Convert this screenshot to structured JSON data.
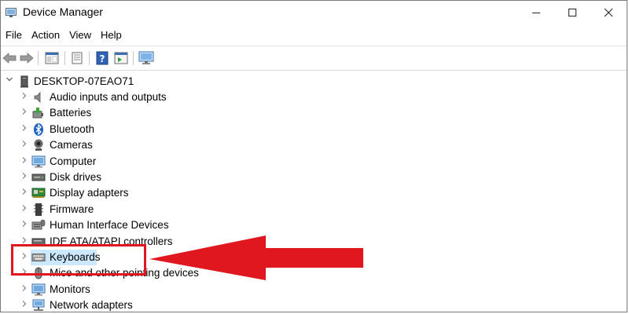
{
  "window": {
    "title": "Device Manager",
    "controls": {
      "minimize": "—",
      "maximize": "☐",
      "close": "✕"
    }
  },
  "menu": {
    "items": [
      "File",
      "Action",
      "View",
      "Help"
    ]
  },
  "toolbar": {
    "buttons": [
      "back-icon",
      "forward-icon",
      "show-hide-console-tree-icon",
      "properties-icon",
      "help-icon",
      "action-pane-icon",
      "monitor-icon"
    ]
  },
  "tree": {
    "root": "DESKTOP-07EAO71",
    "items": [
      {
        "label": "Audio inputs and outputs",
        "icon": "speaker-icon"
      },
      {
        "label": "Batteries",
        "icon": "battery-icon"
      },
      {
        "label": "Bluetooth",
        "icon": "bluetooth-icon"
      },
      {
        "label": "Cameras",
        "icon": "camera-icon"
      },
      {
        "label": "Computer",
        "icon": "computer-icon"
      },
      {
        "label": "Disk drives",
        "icon": "disk-drive-icon"
      },
      {
        "label": "Display adapters",
        "icon": "display-adapter-icon"
      },
      {
        "label": "Firmware",
        "icon": "firmware-icon"
      },
      {
        "label": "Human Interface Devices",
        "icon": "hid-icon"
      },
      {
        "label": "IDE ATA/ATAPI controllers",
        "icon": "ide-controller-icon"
      },
      {
        "label": "Keyboards",
        "icon": "keyboard-icon",
        "selected": true
      },
      {
        "label": "Mice and other pointing devices",
        "icon": "mouse-icon"
      },
      {
        "label": "Monitors",
        "icon": "monitor-icon"
      },
      {
        "label": "Network adapters",
        "icon": "network-adapter-icon"
      }
    ]
  },
  "annotation": {
    "color": "#e0171f",
    "target": "Keyboards"
  }
}
